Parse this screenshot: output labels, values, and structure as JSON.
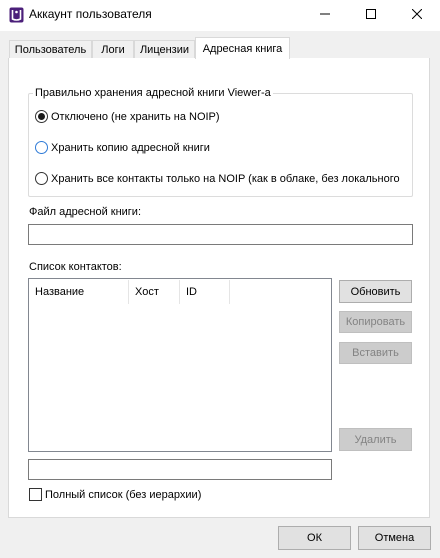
{
  "window": {
    "title": "Аккаунт пользователя"
  },
  "tabs": [
    {
      "label": "Пользователь",
      "active": false
    },
    {
      "label": "Логи",
      "active": false
    },
    {
      "label": "Лицензии",
      "active": false
    },
    {
      "label": "Адресная книга",
      "active": true
    }
  ],
  "storage_group": {
    "title": "Правильно хранения адресной книги Viewer-а",
    "options": [
      {
        "label": "Отключено (не хранить на NOIP)",
        "checked": true
      },
      {
        "label": "Хранить копию адресной книги",
        "checked": false
      },
      {
        "label": "Хранить все контакты только на NOIP (как в облаке, без локального",
        "checked": false
      }
    ]
  },
  "address_book_file": {
    "label": "Файл адресной книги:",
    "value": ""
  },
  "contacts": {
    "label": "Список контактов:",
    "columns": [
      "Название",
      "Хост",
      "ID"
    ],
    "rows": [],
    "filter_value": ""
  },
  "buttons": {
    "refresh": "Обновить",
    "copy": "Копировать",
    "paste": "Вставить",
    "delete": "Удалить",
    "ok": "ОК",
    "cancel": "Отмена"
  },
  "full_list": {
    "label": "Полный список (без иерархии)",
    "checked": false
  },
  "colors": {
    "app_icon": "#4b1f7a",
    "window_bg": "#f0f0f0",
    "focus_accent": "#2f7bd7"
  },
  "icons": {
    "app": "app-icon",
    "minimize": "minimize-icon",
    "maximize": "maximize-icon",
    "close": "close-icon"
  }
}
